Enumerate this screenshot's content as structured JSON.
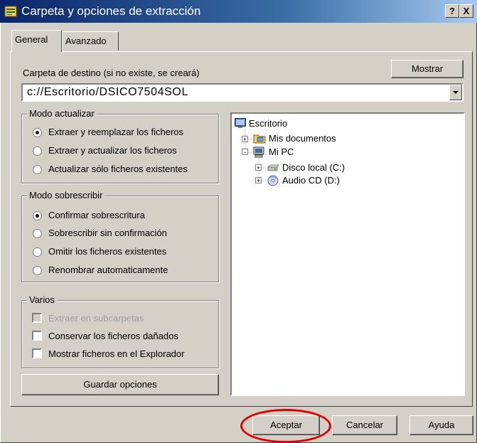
{
  "window": {
    "title": "Carpeta y opciones de extracción",
    "help_btn": "?",
    "close_btn": "X"
  },
  "tabs": [
    {
      "label": "General",
      "active": true
    },
    {
      "label": "Avanzado",
      "active": false
    }
  ],
  "destination": {
    "label": "Carpeta de destino (si no existe, se creará)",
    "show_button": "Mostrar",
    "value": "c://Escritorio/DSICO7504SOL"
  },
  "update_mode": {
    "title": "Modo actualizar",
    "options": [
      {
        "label": "Extraer y reemplazar los ficheros",
        "checked": true
      },
      {
        "label": "Extraer y actualizar los ficheros",
        "checked": false
      },
      {
        "label": "Actualizar sólo ficheros existentes",
        "checked": false
      }
    ]
  },
  "overwrite_mode": {
    "title": "Modo sobrescribir",
    "options": [
      {
        "label": "Confirmar sobrescritura",
        "checked": true
      },
      {
        "label": "Sobrescribir sin confirmación",
        "checked": false
      },
      {
        "label": "Omitir los ficheros existentes",
        "checked": false
      },
      {
        "label": "Renombrar automaticamente",
        "checked": false
      }
    ]
  },
  "misc": {
    "title": "Varios",
    "options": [
      {
        "label": "Extraer en subcarpetas",
        "checked": false,
        "disabled": true
      },
      {
        "label": "Conservar los ficheros dañados",
        "checked": false,
        "disabled": false
      },
      {
        "label": "Mostrar ficheros en el Explorador",
        "checked": false,
        "disabled": false
      }
    ]
  },
  "save_button": "Guardar opciones",
  "tree": {
    "items": [
      {
        "label": "Escritorio",
        "icon": "desktop-icon",
        "expander": ""
      },
      {
        "label": "Mis documentos",
        "icon": "folder-icon",
        "expander": "+"
      },
      {
        "label": "Mi PC",
        "icon": "computer-icon",
        "expander": "-"
      },
      {
        "label": "Disco local (C:)",
        "icon": "drive-icon",
        "expander": "+"
      },
      {
        "label": "Audio CD (D:)",
        "icon": "cd-icon",
        "expander": "+"
      }
    ]
  },
  "footer": {
    "ok": "Aceptar",
    "cancel": "Cancelar",
    "help": "Ayuda"
  },
  "colors": {
    "title_start": "#0a246a",
    "title_end": "#a6caf0",
    "face": "#d4d0c8",
    "highlight": "#e00000"
  }
}
